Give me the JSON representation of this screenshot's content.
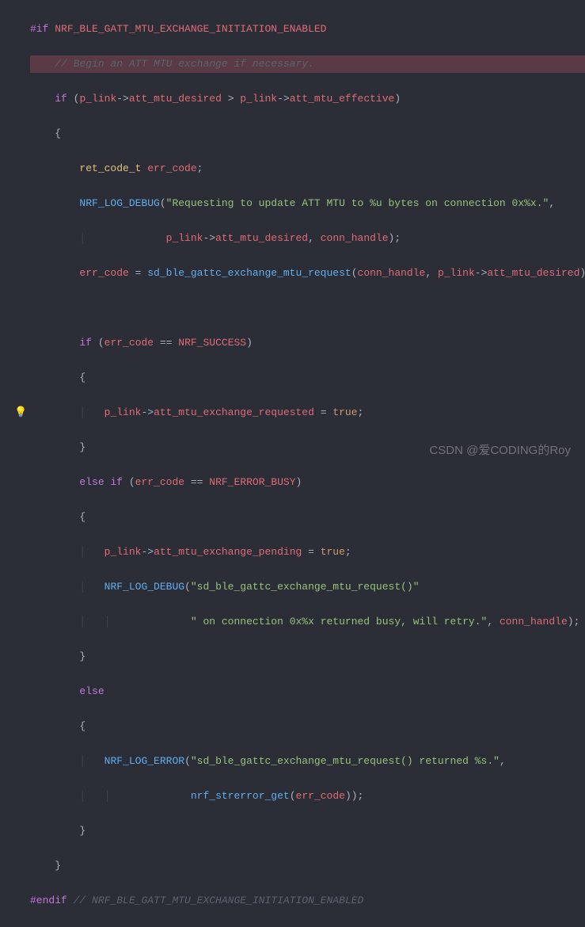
{
  "code": {
    "pp_if": "#if",
    "pp_endif": "#endif",
    "macro_name": "NRF_BLE_GATT_MTU_EXCHANGE_INITIATION_ENABLED",
    "comment_begin": "// Begin an ATT MTU exchange if necessary.",
    "comment_end": "// NRF_BLE_GATT_MTU_EXCHANGE_INITIATION_ENABLED",
    "kw_if": "if",
    "kw_else": "else",
    "kw_else_if": "else if",
    "obj": "p_link",
    "arrow": "->",
    "field_desired": "att_mtu_desired",
    "field_effective": "att_mtu_effective",
    "field_exchange_requested": "att_mtu_exchange_requested",
    "field_exchange_pending": "att_mtu_exchange_pending",
    "type_ret": "ret_code_t",
    "var_err": "err_code",
    "var_conn": "conn_handle",
    "fn_log_debug": "NRF_LOG_DEBUG",
    "fn_log_error": "NRF_LOG_ERROR",
    "fn_sd_exchange": "sd_ble_gattc_exchange_mtu_request",
    "fn_strerror": "nrf_strerror_get",
    "const_success": "NRF_SUCCESS",
    "const_busy": "NRF_ERROR_BUSY",
    "val_true": "true",
    "str_req_mtu": "\"Requesting to update ATT MTU to %u bytes on connection 0x%x.\"",
    "str_busy1": "\"sd_ble_gattc_exchange_mtu_request()\"",
    "str_busy2": "\" on connection 0x%x returned busy, will retry.\"",
    "str_err": "\"sd_ble_gattc_exchange_mtu_request() returned %s.\""
  },
  "watermark": "CSDN @爱CODING的Roy",
  "icons": {
    "bulb": "💡"
  }
}
